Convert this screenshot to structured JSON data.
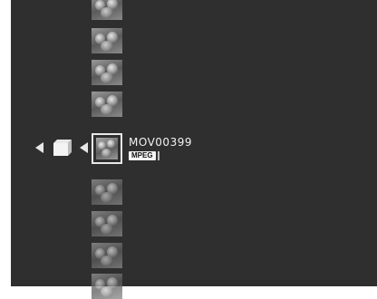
{
  "selected_file": {
    "name": "MOV00399",
    "format": "MPEG"
  },
  "thumbnails_above": [
    {
      "kind": "photo"
    },
    {
      "kind": "photo"
    },
    {
      "kind": "photo"
    },
    {
      "kind": "photo"
    }
  ],
  "thumbnails_below": [
    {
      "kind": "photo"
    },
    {
      "kind": "photo"
    },
    {
      "kind": "photo"
    },
    {
      "kind": "photo"
    }
  ],
  "icons": {
    "back_arrow": "arrow-left-icon",
    "folder": "folder-icon",
    "select_arrow": "arrow-left-icon"
  },
  "colors": {
    "background": "#2f2f2f",
    "highlight": "#e8e8e8"
  }
}
